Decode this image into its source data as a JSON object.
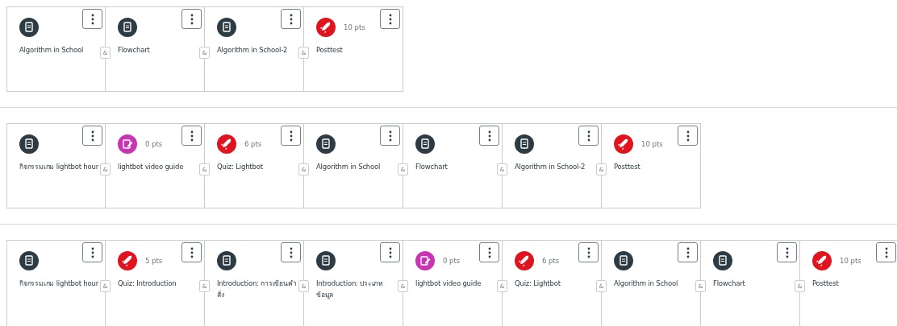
{
  "rows": [
    {
      "items": [
        {
          "kind": "page",
          "title": "Algorithm in School",
          "connector": "&"
        },
        {
          "kind": "page",
          "title": "Flowchart",
          "connector": "&"
        },
        {
          "kind": "page",
          "title": "Algorithm in School-2",
          "connector": "&"
        },
        {
          "kind": "quiz",
          "points": "10 pts",
          "title": "Posttest"
        }
      ]
    },
    {
      "items": [
        {
          "kind": "page",
          "title": "กิจกรรมเกม lightbot hour",
          "connector": "&"
        },
        {
          "kind": "assignment",
          "points": "0 pts",
          "title": "lightbot video guide",
          "connector": "&"
        },
        {
          "kind": "quiz",
          "points": "6 pts",
          "title": "Quiz: Lightbot",
          "connector": "&"
        },
        {
          "kind": "page",
          "title": "Algorithm in School",
          "connector": "&"
        },
        {
          "kind": "page",
          "title": "Flowchart",
          "connector": "&"
        },
        {
          "kind": "page",
          "title": "Algorithm in School-2",
          "connector": "&"
        },
        {
          "kind": "quiz",
          "points": "10 pts",
          "title": "Posttest"
        }
      ]
    },
    {
      "items": [
        {
          "kind": "page",
          "title": "กิจกรรมเกม lightbot hour",
          "connector": "&"
        },
        {
          "kind": "quiz",
          "points": "5 pts",
          "title": "Quiz: Introduction",
          "connector": "&"
        },
        {
          "kind": "page",
          "title": "Introduction: การเขียนคำสั่ง",
          "connector": "&"
        },
        {
          "kind": "page",
          "title": "Introduction: ประเภทข้อมูล",
          "connector": "&"
        },
        {
          "kind": "assignment",
          "points": "0 pts",
          "title": "lightbot video guide",
          "connector": "&"
        },
        {
          "kind": "quiz",
          "points": "6 pts",
          "title": "Quiz: Lightbot",
          "connector": "&"
        },
        {
          "kind": "page",
          "title": "Algorithm in School",
          "connector": "&"
        },
        {
          "kind": "page",
          "title": "Flowchart",
          "connector": "&"
        },
        {
          "kind": "quiz",
          "points": "10 pts",
          "title": "Posttest"
        }
      ]
    }
  ]
}
